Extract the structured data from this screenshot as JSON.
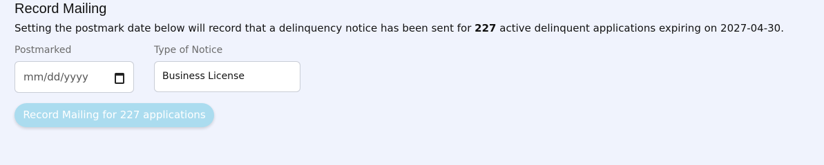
{
  "title": "Record Mailing",
  "description": {
    "before": "Setting the postmark date below will record that a delinquency notice has been sent for ",
    "count": "227",
    "after": " active delinquent applications expiring on 2027-04-30."
  },
  "postmarked": {
    "label": "Postmarked",
    "placeholder": "mm/dd/yyyy"
  },
  "notice_type": {
    "label": "Type of Notice",
    "value": "Business License"
  },
  "submit_button": {
    "label": "Record Mailing for 227 applications",
    "disabled": true
  },
  "colors": {
    "background": "#f0f3fd",
    "button_disabled": "#abdcef"
  },
  "icons": {
    "date": "calendar-icon"
  }
}
